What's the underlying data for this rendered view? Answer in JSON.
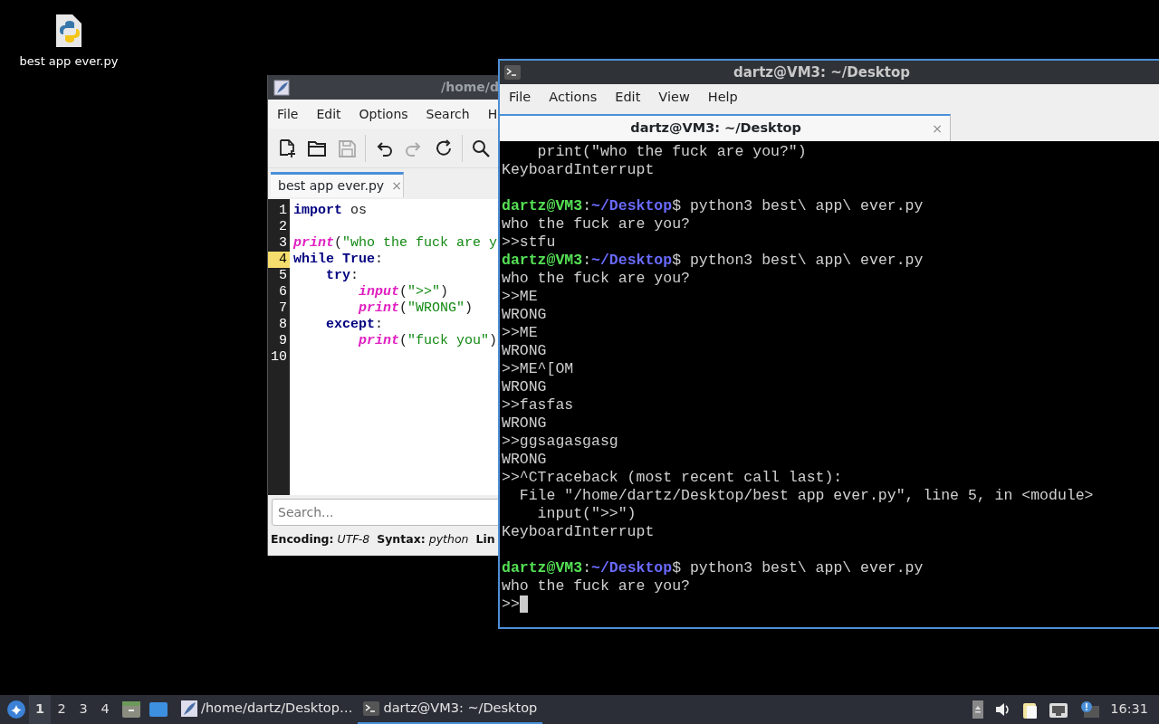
{
  "desktop": {
    "icons": [
      {
        "label": "best app ever.py"
      }
    ]
  },
  "editor": {
    "title": "/home/d",
    "menu": [
      "File",
      "Edit",
      "Options",
      "Search",
      "H"
    ],
    "toolbar": [
      {
        "kind": "new",
        "disabled": false
      },
      {
        "kind": "open",
        "disabled": false
      },
      {
        "kind": "save",
        "disabled": true
      },
      {
        "kind": "undo",
        "disabled": false
      },
      {
        "kind": "redo",
        "disabled": true
      },
      {
        "kind": "reload",
        "disabled": false
      },
      {
        "kind": "search",
        "disabled": false
      }
    ],
    "tabs": [
      {
        "label": "best app ever.py",
        "close": "×",
        "selected": true
      }
    ],
    "lines": [
      {
        "number": "1",
        "current": false,
        "tokens": [
          {
            "kind": "kw",
            "text": "import"
          },
          {
            "kind": "text",
            "text": " os"
          }
        ]
      },
      {
        "number": "2",
        "current": false
      },
      {
        "number": "3",
        "current": false,
        "tokens": [
          {
            "kind": "fn",
            "text": "print"
          },
          {
            "kind": "text",
            "text": "("
          },
          {
            "kind": "str",
            "text": "\"who the fuck are y"
          }
        ]
      },
      {
        "number": "4",
        "current": true,
        "tokens": [
          {
            "kind": "kw",
            "text": "while True"
          },
          {
            "kind": "text",
            "text": ":"
          }
        ]
      },
      {
        "number": "5",
        "current": false,
        "tokens": [
          {
            "kind": "kw",
            "text": "    try"
          },
          {
            "kind": "text",
            "text": ":"
          }
        ]
      },
      {
        "number": "6",
        "current": false,
        "tokens": [
          {
            "kind": "fn",
            "text": "        input"
          },
          {
            "kind": "text",
            "text": "("
          },
          {
            "kind": "str",
            "text": "\">>\""
          },
          {
            "kind": "text",
            "text": ")"
          }
        ]
      },
      {
        "number": "7",
        "current": false,
        "tokens": [
          {
            "kind": "fn",
            "text": "        print"
          },
          {
            "kind": "text",
            "text": "("
          },
          {
            "kind": "str",
            "text": "\"WRONG\""
          },
          {
            "kind": "text",
            "text": ")"
          }
        ]
      },
      {
        "number": "8",
        "current": false,
        "tokens": [
          {
            "kind": "kw",
            "text": "    except"
          },
          {
            "kind": "text",
            "text": ":"
          }
        ]
      },
      {
        "number": "9",
        "current": false,
        "tokens": [
          {
            "kind": "fn",
            "text": "        print"
          },
          {
            "kind": "text",
            "text": "("
          },
          {
            "kind": "str",
            "text": "\"fuck you\""
          },
          {
            "kind": "text",
            "text": ")"
          }
        ]
      },
      {
        "number": "10",
        "current": false
      }
    ],
    "search": {
      "placeholder": "Search..."
    },
    "status": "**Encoding:** *UTF-8*  **Syntax:** *python*  **Lin**"
  },
  "terminal": {
    "title": "dartz@VM3: ~/Desktop",
    "menu": [
      "File",
      "Actions",
      "Edit",
      "View",
      "Help"
    ],
    "tabs": [
      {
        "label": "dartz@VM3: ~/Desktop",
        "close": "×",
        "selected": true
      }
    ],
    "lines": [
      {
        "kind": "text",
        "text": "    print(\"who the fuck are you?\")"
      },
      {
        "kind": "text",
        "text": "KeyboardInterrupt"
      },
      {
        "kind": "blank"
      },
      {
        "kind": "prompt",
        "user": "dartz@VM3",
        "sep": ":",
        "path": "~/Desktop",
        "command": "$ python3 best\\ app\\ ever.py"
      },
      {
        "kind": "text",
        "text": "who the fuck are you?"
      },
      {
        "kind": "text",
        "text": ">>stfu"
      },
      {
        "kind": "prompt",
        "user": "dartz@VM3",
        "sep": ":",
        "path": "~/Desktop",
        "command": "$ python3 best\\ app\\ ever.py"
      },
      {
        "kind": "text",
        "text": "who the fuck are you?"
      },
      {
        "kind": "text",
        "text": ">>ME"
      },
      {
        "kind": "text",
        "text": "WRONG"
      },
      {
        "kind": "text",
        "text": ">>ME"
      },
      {
        "kind": "text",
        "text": "WRONG"
      },
      {
        "kind": "text",
        "text": ">>ME^[OM"
      },
      {
        "kind": "text",
        "text": "WRONG"
      },
      {
        "kind": "text",
        "text": ">>fasfas"
      },
      {
        "kind": "text",
        "text": "WRONG"
      },
      {
        "kind": "text",
        "text": ">>ggsagasgasg"
      },
      {
        "kind": "text",
        "text": "WRONG"
      },
      {
        "kind": "text",
        "text": ">>^CTraceback (most recent call last):"
      },
      {
        "kind": "text",
        "text": "  File \"/home/dartz/Desktop/best app ever.py\", line 5, in <module>"
      },
      {
        "kind": "text",
        "text": "    input(\">>\")"
      },
      {
        "kind": "text",
        "text": "KeyboardInterrupt"
      },
      {
        "kind": "blank"
      },
      {
        "kind": "prompt",
        "user": "dartz@VM3",
        "sep": ":",
        "path": "~/Desktop",
        "command": "$ python3 best\\ app\\ ever.py"
      },
      {
        "kind": "text",
        "text": "who the fuck are you?"
      },
      {
        "kind": "input",
        "text": ">>",
        "cursor": true
      }
    ]
  },
  "taskbar": {
    "workspaces": [
      {
        "label": "1",
        "selected": true
      },
      {
        "label": "2",
        "selected": false
      },
      {
        "label": "3",
        "selected": false
      },
      {
        "label": "4",
        "selected": false
      }
    ],
    "tasks": [
      {
        "kind": "editor",
        "label": "/home/dartz/Desktop…",
        "selected": false
      },
      {
        "kind": "terminal",
        "label": "dartz@VM3: ~/Desktop",
        "selected": true
      }
    ],
    "clock": "16:31"
  }
}
